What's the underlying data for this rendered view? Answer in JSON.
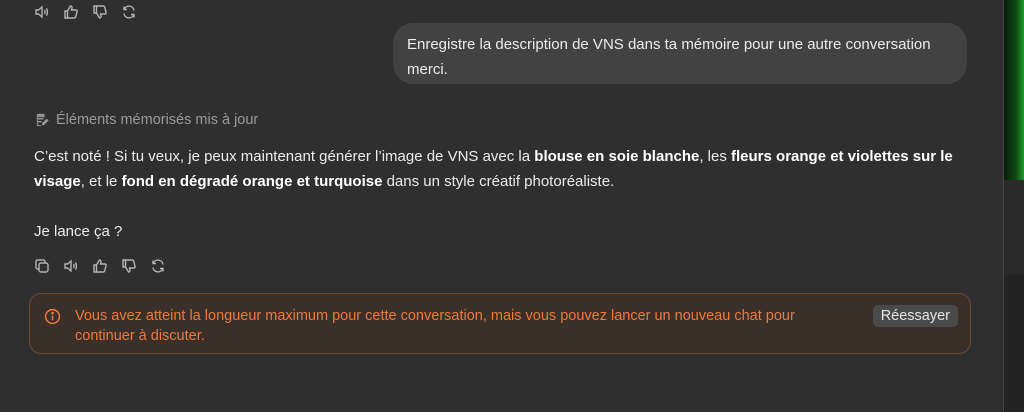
{
  "top_actions": {
    "icons": [
      "speaker-icon",
      "thumbs-up-icon",
      "thumbs-down-icon",
      "regenerate-icon"
    ]
  },
  "user_message": {
    "text": "Enregistre la description de VNS dans ta mémoire pour une autre conversation merci."
  },
  "memory_update": {
    "label": "Éléments mémorisés mis à jour"
  },
  "assistant_message": {
    "part1": "C’est noté ! Si tu veux, je peux maintenant générer l’image de VNS avec la ",
    "bold1": "blouse en soie blanche",
    "part2": ", les ",
    "bold2": "fleurs orange et violettes sur le visage",
    "part3": ", et le ",
    "bold3": "fond en dégradé orange et turquoise",
    "part4": " dans un style créatif photoréaliste.",
    "question": "Je lance ça ?"
  },
  "bottom_actions": {
    "icons": [
      "copy-icon",
      "speaker-icon",
      "thumbs-up-icon",
      "thumbs-down-icon",
      "regenerate-icon"
    ]
  },
  "error": {
    "text": "Vous avez atteint la longueur maximum pour cette conversation, mais vous pouvez lancer un nouveau chat pour continuer à discuter.",
    "retry_label": "Réessayer",
    "color": "#f07a3a"
  }
}
